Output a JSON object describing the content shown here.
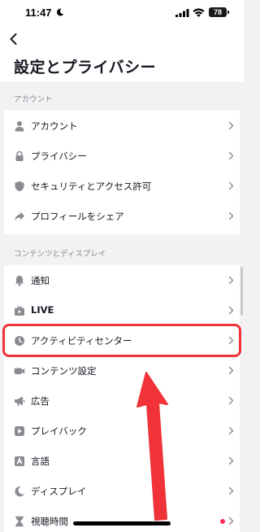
{
  "status_bar": {
    "time": "11:47",
    "battery": "78"
  },
  "header": {
    "title": "設定とプライバシー"
  },
  "sections": [
    {
      "title": "アカウント",
      "items": [
        {
          "label": "アカウント",
          "icon": "person-icon"
        },
        {
          "label": "プライバシー",
          "icon": "lock-icon"
        },
        {
          "label": "セキュリティとアクセス許可",
          "icon": "shield-icon"
        },
        {
          "label": "プロフィールをシェア",
          "icon": "share-icon"
        }
      ]
    },
    {
      "title": "コンテンツとディスプレイ",
      "items": [
        {
          "label": "通知",
          "icon": "bell-icon"
        },
        {
          "label": "LIVE",
          "icon": "live-tv-icon"
        },
        {
          "label": "アクティビティセンター",
          "icon": "clock-icon",
          "highlighted": true
        },
        {
          "label": "コンテンツ設定",
          "icon": "video-camera-icon"
        },
        {
          "label": "広告",
          "icon": "megaphone-icon"
        },
        {
          "label": "プレイバック",
          "icon": "play-icon"
        },
        {
          "label": "言語",
          "icon": "language-icon"
        },
        {
          "label": "ディスプレイ",
          "icon": "moon-icon"
        },
        {
          "label": "視聴時間",
          "icon": "hourglass-icon",
          "badge_dot": true
        }
      ]
    }
  ],
  "colors": {
    "background": "#f2f2f4",
    "card": "#ffffff",
    "text": "#161823",
    "section_header": "#8a8b91",
    "icon": "#8a8b91",
    "highlight": "#ef3338",
    "badge_dot": "#fe2c55"
  }
}
